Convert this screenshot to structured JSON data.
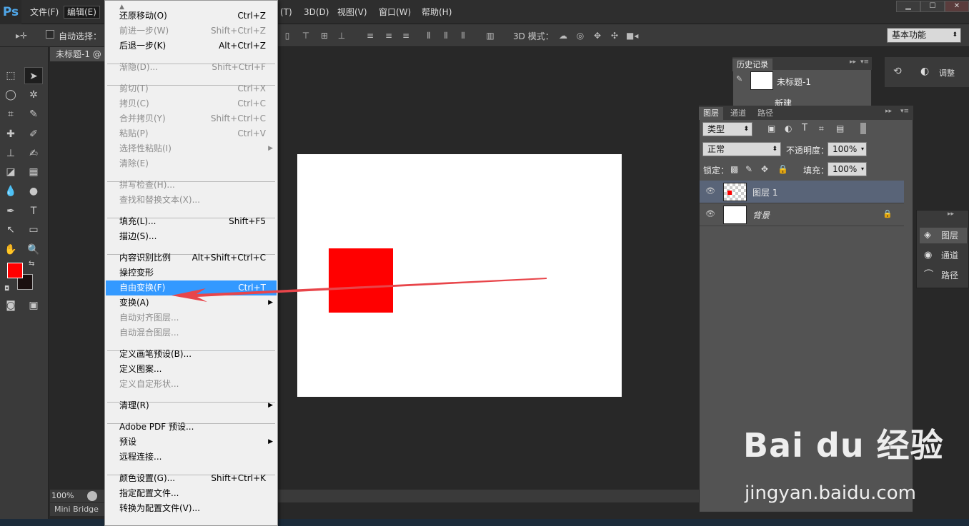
{
  "app": {
    "logo": "Ps"
  },
  "menubar": {
    "items": [
      "文件(F)",
      "编辑(E)",
      "(T)",
      "3D(D)",
      "视图(V)",
      "窗口(W)",
      "帮助(H)"
    ]
  },
  "window_controls": {
    "minimize": "▁",
    "restore": "☐",
    "close": "✕"
  },
  "options_bar": {
    "auto_select": "自动选择：",
    "mode_3d": "3D 模式：",
    "workspace": "基本功能"
  },
  "document": {
    "tab_title": "未标题-1 @",
    "zoom": "100%"
  },
  "mini_bridge": "Mini Bridge",
  "edit_menu": {
    "items": [
      {
        "label": "还原移动(O)",
        "shortcut": "Ctrl+Z",
        "disabled": false
      },
      {
        "label": "前进一步(W)",
        "shortcut": "Shift+Ctrl+Z",
        "disabled": true
      },
      {
        "label": "后退一步(K)",
        "shortcut": "Alt+Ctrl+Z",
        "disabled": false
      },
      {
        "label": "渐隐(D)...",
        "shortcut": "Shift+Ctrl+F",
        "disabled": true
      },
      {
        "label": "剪切(T)",
        "shortcut": "Ctrl+X",
        "disabled": true
      },
      {
        "label": "拷贝(C)",
        "shortcut": "Ctrl+C",
        "disabled": true
      },
      {
        "label": "合并拷贝(Y)",
        "shortcut": "Shift+Ctrl+C",
        "disabled": true
      },
      {
        "label": "粘贴(P)",
        "shortcut": "Ctrl+V",
        "disabled": true
      },
      {
        "label": "选择性粘贴(I)",
        "shortcut": "",
        "disabled": true,
        "submenu": true
      },
      {
        "label": "清除(E)",
        "shortcut": "",
        "disabled": true
      },
      {
        "label": "拼写检查(H)...",
        "shortcut": "",
        "disabled": true
      },
      {
        "label": "查找和替换文本(X)...",
        "shortcut": "",
        "disabled": true
      },
      {
        "label": "填充(L)...",
        "shortcut": "Shift+F5",
        "disabled": false
      },
      {
        "label": "描边(S)...",
        "shortcut": "",
        "disabled": false
      },
      {
        "label": "内容识别比例",
        "shortcut": "Alt+Shift+Ctrl+C",
        "disabled": false
      },
      {
        "label": "操控变形",
        "shortcut": "",
        "disabled": false
      },
      {
        "label": "自由变换(F)",
        "shortcut": "Ctrl+T",
        "disabled": false,
        "highlighted": true
      },
      {
        "label": "变换(A)",
        "shortcut": "",
        "disabled": false,
        "submenu": true
      },
      {
        "label": "自动对齐图层...",
        "shortcut": "",
        "disabled": true
      },
      {
        "label": "自动混合图层...",
        "shortcut": "",
        "disabled": true
      },
      {
        "label": "定义画笔预设(B)...",
        "shortcut": "",
        "disabled": false
      },
      {
        "label": "定义图案...",
        "shortcut": "",
        "disabled": false
      },
      {
        "label": "定义自定形状...",
        "shortcut": "",
        "disabled": true
      },
      {
        "label": "清理(R)",
        "shortcut": "",
        "disabled": false,
        "submenu": true
      },
      {
        "label": "Adobe PDF 预设...",
        "shortcut": "",
        "disabled": false
      },
      {
        "label": "预设",
        "shortcut": "",
        "disabled": false,
        "submenu": true
      },
      {
        "label": "远程连接...",
        "shortcut": "",
        "disabled": false
      },
      {
        "label": "颜色设置(G)...",
        "shortcut": "Shift+Ctrl+K",
        "disabled": false
      },
      {
        "label": "指定配置文件...",
        "shortcut": "",
        "disabled": false
      },
      {
        "label": "转换为配置文件(V)...",
        "shortcut": "",
        "disabled": false
      }
    ]
  },
  "history_panel": {
    "tab": "历史记录",
    "snapshot": "未标题-1",
    "step": "新建"
  },
  "adjust_panel": {
    "label": "调整"
  },
  "layers_panel": {
    "tabs": [
      "图层",
      "通道",
      "路径"
    ],
    "filter": "类型",
    "blend_mode": "正常",
    "opacity_label": "不透明度：",
    "opacity": "100%",
    "lock_label": "锁定：",
    "fill_label": "填充：",
    "fill": "100%",
    "layers": [
      {
        "name": "图层 1",
        "selected": true
      },
      {
        "name": "背景",
        "selected": false,
        "locked": true
      }
    ]
  },
  "side_panel": {
    "items": [
      "图层",
      "通道",
      "路径"
    ]
  },
  "colors": {
    "foreground": "#ff0000",
    "background": "#1a1010",
    "highlight": "#3399ff",
    "arrow": "#e8454a"
  },
  "watermark": {
    "brand": "Bai du 经验",
    "url": "jingyan.baidu.com"
  }
}
